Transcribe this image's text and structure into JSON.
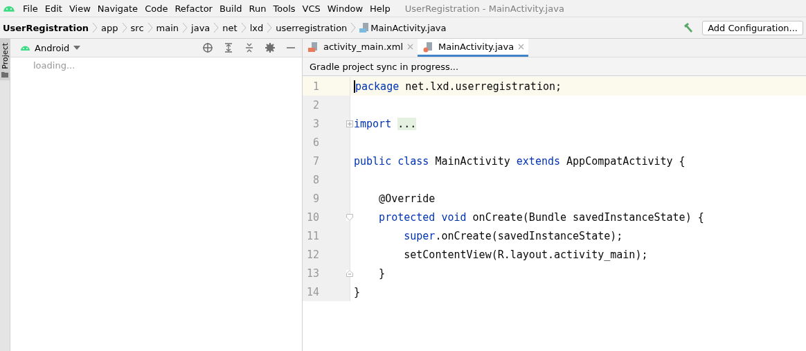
{
  "menu": [
    "File",
    "Edit",
    "View",
    "Navigate",
    "Code",
    "Refactor",
    "Build",
    "Run",
    "Tools",
    "VCS",
    "Window",
    "Help"
  ],
  "window": {
    "title": "UserRegistration - MainActivity.java"
  },
  "breadcrumbs": [
    {
      "label": "UserRegistration",
      "kind": "project"
    },
    {
      "label": "app",
      "kind": "folder"
    },
    {
      "label": "src",
      "kind": "folder"
    },
    {
      "label": "main",
      "kind": "folder"
    },
    {
      "label": "java",
      "kind": "folder"
    },
    {
      "label": "net",
      "kind": "folder"
    },
    {
      "label": "lxd",
      "kind": "folder"
    },
    {
      "label": "userregistration",
      "kind": "folder"
    },
    {
      "label": "MainActivity.java",
      "kind": "file"
    }
  ],
  "run_config": {
    "label": "Add Configuration..."
  },
  "side_tab": {
    "label": "Project"
  },
  "project_panel": {
    "view": "Android",
    "status": "loading..."
  },
  "editor_tabs": [
    {
      "label": "activity_main.xml",
      "kind": "xml",
      "selected": false
    },
    {
      "label": "MainActivity.java",
      "kind": "java",
      "selected": true
    }
  ],
  "notification": "Gradle project sync in progress...",
  "lines": [
    {
      "number": "1",
      "current": true,
      "kind": "plain",
      "tokens": [
        {
          "text": "package",
          "kind": "keyword"
        },
        {
          "text": " net.lxd.userregistration;",
          "kind": "plain"
        }
      ]
    },
    {
      "number": "2",
      "current": false,
      "kind": "plain"
    },
    {
      "number": "3",
      "current": false,
      "kind": "collapsed",
      "tokens": [
        {
          "text": "import",
          "kind": "keyword"
        },
        {
          "text": "...",
          "kind": "folded"
        }
      ]
    },
    {
      "number": "6",
      "current": false,
      "kind": "plain"
    },
    {
      "number": "7",
      "current": false,
      "kind": "plain",
      "tokens": [
        {
          "text": "public class",
          "kind": "keyword"
        },
        {
          "text": " MainActivity ",
          "kind": "plain"
        },
        {
          "text": "extends",
          "kind": "keyword"
        },
        {
          "text": " AppCompatActivity {",
          "kind": "plain"
        }
      ]
    },
    {
      "number": "8",
      "current": false,
      "kind": "plain"
    },
    {
      "number": "9",
      "current": false,
      "kind": "plain",
      "tokens": [
        {
          "text": "    @Override",
          "kind": "plain"
        }
      ]
    },
    {
      "number": "10",
      "current": false,
      "kind": "opener",
      "tokens": [
        {
          "text": "    protected void",
          "kind": "keyword"
        },
        {
          "text": " onCreate(Bundle savedInstanceState) {",
          "kind": "plain"
        }
      ]
    },
    {
      "number": "11",
      "current": false,
      "kind": "plain",
      "tokens": [
        {
          "text": "        super",
          "kind": "keyword"
        },
        {
          "text": ".onCreate(savedInstanceState);",
          "kind": "plain"
        }
      ]
    },
    {
      "number": "12",
      "current": false,
      "kind": "plain",
      "tokens": [
        {
          "text": "        setContentView(R.layout.activity_main);",
          "kind": "plain"
        }
      ]
    },
    {
      "number": "13",
      "current": false,
      "kind": "closer",
      "tokens": [
        {
          "text": "    }",
          "kind": "plain"
        }
      ]
    },
    {
      "number": "14",
      "current": false,
      "kind": "plain",
      "tokens": [
        {
          "text": "}",
          "kind": "plain"
        }
      ]
    }
  ]
}
